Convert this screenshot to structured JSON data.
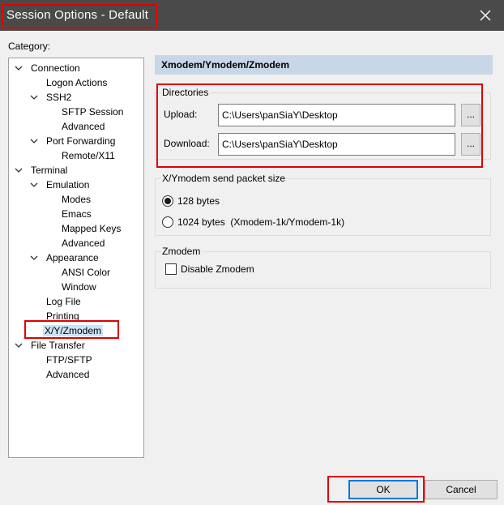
{
  "window": {
    "title": "Session Options - Default"
  },
  "category_label": "Category:",
  "tree": [
    {
      "label": "Connection",
      "expanded": true
    },
    {
      "label": "Logon Actions"
    },
    {
      "label": "SSH2",
      "expanded": true
    },
    {
      "label": "SFTP Session"
    },
    {
      "label": "Advanced"
    },
    {
      "label": "Port Forwarding",
      "expanded": true
    },
    {
      "label": "Remote/X11"
    },
    {
      "label": "Terminal",
      "expanded": true
    },
    {
      "label": "Emulation",
      "expanded": true
    },
    {
      "label": "Modes"
    },
    {
      "label": "Emacs"
    },
    {
      "label": "Mapped Keys"
    },
    {
      "label": "Advanced"
    },
    {
      "label": "Appearance",
      "expanded": true
    },
    {
      "label": "ANSI Color"
    },
    {
      "label": "Window"
    },
    {
      "label": "Log File"
    },
    {
      "label": "Printing"
    },
    {
      "label": "X/Y/Zmodem",
      "selected": true
    },
    {
      "label": "File Transfer",
      "expanded": true
    },
    {
      "label": "FTP/SFTP"
    },
    {
      "label": "Advanced"
    }
  ],
  "panel": {
    "header": "Xmodem/Ymodem/Zmodem",
    "directories": {
      "title": "Directories",
      "upload_label": "Upload:",
      "upload_value": "C:\\Users\\panSiaY\\Desktop",
      "download_label": "Download:",
      "download_value": "C:\\Users\\panSiaY\\Desktop",
      "browse_label": "..."
    },
    "packet_size": {
      "title": "X/Ymodem send packet size",
      "option_128": "128 bytes",
      "option_1024": "1024 bytes  (Xmodem-1k/Ymodem-1k)",
      "selected": "128 bytes"
    },
    "zmodem": {
      "title": "Zmodem",
      "disable_label": "Disable Zmodem",
      "disable_checked": false
    }
  },
  "buttons": {
    "ok": "OK",
    "cancel": "Cancel"
  },
  "colors": {
    "titlebar": "#4a4a4a",
    "highlight": "#e00000",
    "selection": "#cce4f7",
    "header": "#c7d7e7",
    "focus": "#0078d7"
  }
}
